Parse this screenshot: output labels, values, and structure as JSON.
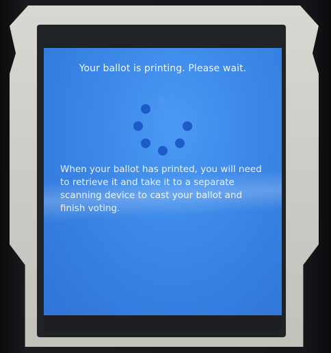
{
  "screen": {
    "status_message": "Your ballot is printing.  Please wait.",
    "info_message": "When your ballot has printed, you will need to retrieve it and take it to a separate scanning device to cast your ballot and finish voting."
  },
  "spinner": {
    "icon": "loading-spinner-icon",
    "dot_count": 8,
    "dot_color": "#1e5bc8",
    "faded_dot_color": "#4e96ee"
  },
  "colors": {
    "screen_background": "#3b86e6",
    "text": "#eef5ff",
    "bezel": "#cfcdc8"
  }
}
